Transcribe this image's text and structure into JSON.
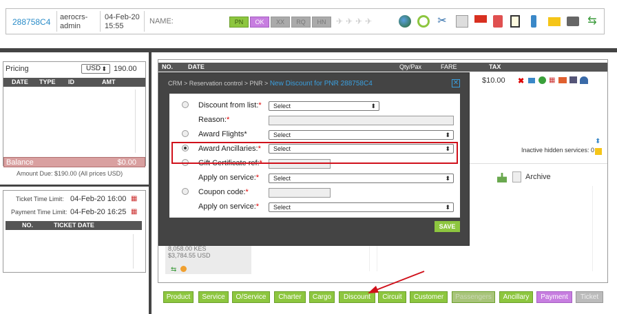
{
  "header": {
    "pnr": "288758C4",
    "user_line1": "aerocrs-",
    "user_line2": "admin",
    "date_line1": "04-Feb-20",
    "date_line2": "15:55",
    "name_label": "NAME:",
    "tags": [
      "PN",
      "OK",
      "XX",
      "RQ",
      "HN"
    ]
  },
  "pricing": {
    "label": "Pricing",
    "currency": "USD",
    "amount": "190.00",
    "columns": [
      "DATE",
      "TYPE",
      "ID",
      "AMT"
    ],
    "balance_label": "Balance",
    "balance_value": "$0.00",
    "amount_due": "Amount Due: $190.00 (All prices USD)"
  },
  "limits": {
    "ticket_label": "Ticket Time Limit:",
    "ticket_value": "04-Feb-20 16:00",
    "payment_label": "Payment Time Limit:",
    "payment_value": "04-Feb-20 16:25",
    "columns": [
      "NO.",
      "TICKET DATE"
    ]
  },
  "services": {
    "columns": [
      "NO.",
      "DATE",
      "Qty/Pax",
      "FARE",
      "TAX"
    ],
    "tax_value": "$10.00",
    "inactive_text": "Inactive hidden services: 0",
    "archive_label": "Archive",
    "price1": "8,058.00 KES",
    "price2": "$3,784.55 USD"
  },
  "modal": {
    "breadcrumb": "CRM > Reservation control > PNR > ",
    "title": "New Discount for PNR 288758C4",
    "rows": [
      {
        "label": "Discount from list:",
        "value": "Select"
      },
      {
        "label": "Reason:"
      },
      {
        "label": "Award Flights*",
        "value": "Select"
      },
      {
        "label": "Award Ancillaries:",
        "value": "Select"
      },
      {
        "label": "Gift Certificate ref:"
      },
      {
        "label": "Apply on service:",
        "value": "Select"
      },
      {
        "label": "Coupon code:"
      },
      {
        "label": "Apply on service:",
        "value": "Select"
      }
    ],
    "save_label": "SAVE"
  },
  "bottom_buttons": [
    "Product",
    "Service",
    "O/Service",
    "Charter",
    "Cargo",
    "Discount",
    "Circuit",
    "Customer",
    "Passengers",
    "Ancillary",
    "Payment",
    "Ticket"
  ],
  "colors": {
    "accent_blue": "#2a8cc8",
    "green_button": "#8dc63f",
    "purple_button": "#c77ee0",
    "highlight_red": "#d0101a",
    "balance_bg": "#d9a0a0"
  }
}
